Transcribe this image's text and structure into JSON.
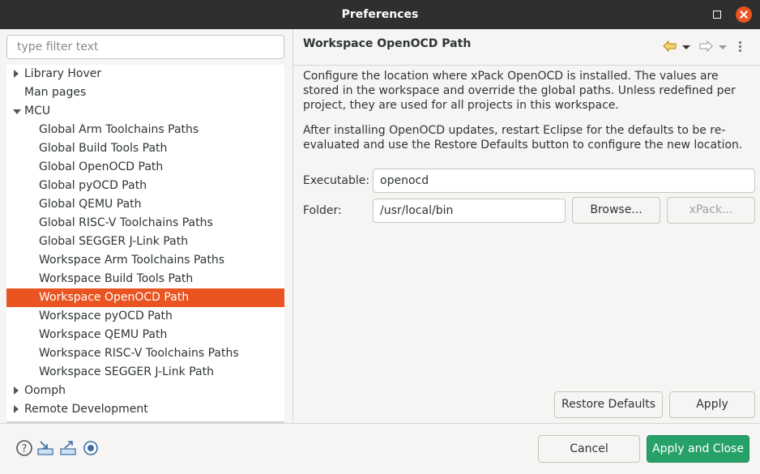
{
  "window": {
    "title": "Preferences"
  },
  "filter": {
    "placeholder": "type filter text"
  },
  "tree": [
    {
      "label": "Library Hover",
      "level": 0,
      "expander": "collapsed"
    },
    {
      "label": "Man pages",
      "level": 0,
      "expander": "none"
    },
    {
      "label": "MCU",
      "level": 0,
      "expander": "expanded"
    },
    {
      "label": "Global Arm Toolchains Paths",
      "level": 1,
      "expander": "none"
    },
    {
      "label": "Global Build Tools Path",
      "level": 1,
      "expander": "none"
    },
    {
      "label": "Global OpenOCD Path",
      "level": 1,
      "expander": "none"
    },
    {
      "label": "Global pyOCD Path",
      "level": 1,
      "expander": "none"
    },
    {
      "label": "Global QEMU Path",
      "level": 1,
      "expander": "none"
    },
    {
      "label": "Global RISC-V Toolchains Paths",
      "level": 1,
      "expander": "none"
    },
    {
      "label": "Global SEGGER J-Link Path",
      "level": 1,
      "expander": "none"
    },
    {
      "label": "Workspace Arm Toolchains Paths",
      "level": 1,
      "expander": "none"
    },
    {
      "label": "Workspace Build Tools Path",
      "level": 1,
      "expander": "none"
    },
    {
      "label": "Workspace OpenOCD Path",
      "level": 1,
      "expander": "none",
      "selected": true
    },
    {
      "label": "Workspace pyOCD Path",
      "level": 1,
      "expander": "none"
    },
    {
      "label": "Workspace QEMU Path",
      "level": 1,
      "expander": "none"
    },
    {
      "label": "Workspace RISC-V Toolchains Paths",
      "level": 1,
      "expander": "none"
    },
    {
      "label": "Workspace SEGGER J-Link Path",
      "level": 1,
      "expander": "none"
    },
    {
      "label": "Oomph",
      "level": 0,
      "expander": "collapsed"
    },
    {
      "label": "Remote Development",
      "level": 0,
      "expander": "collapsed"
    }
  ],
  "page": {
    "title": "Workspace OpenOCD Path",
    "description_1": "Configure the location where xPack OpenOCD is installed. The values are stored in the workspace and override the global paths. Unless redefined per project, they are used for all projects in this workspace.",
    "description_2": "After installing OpenOCD updates, restart Eclipse for the defaults to be re-evaluated and use the Restore Defaults button to configure the new location.",
    "executable_label": "Executable:",
    "executable_value": "openocd",
    "folder_label": "Folder:",
    "folder_value": "/usr/local/bin",
    "browse_label": "Browse...",
    "xpack_label": "xPack...",
    "restore_defaults_label": "Restore Defaults",
    "apply_label": "Apply"
  },
  "footer": {
    "cancel_label": "Cancel",
    "apply_close_label": "Apply and Close",
    "icons": [
      "help-icon",
      "import-icon",
      "export-icon",
      "record-icon"
    ]
  },
  "colors": {
    "selection": "#e95420",
    "primary_button": "#26a269",
    "title_bar": "#2f2f2f"
  }
}
